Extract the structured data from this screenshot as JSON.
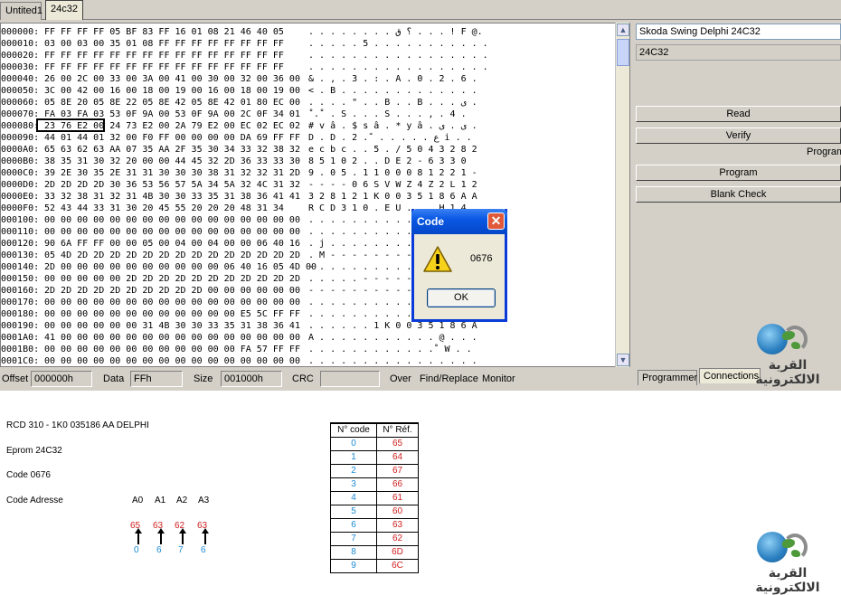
{
  "tabs": [
    {
      "label": "Untited1"
    },
    {
      "label": "24c32"
    }
  ],
  "hex_rows": [
    {
      "offset": "000000:",
      "hex": "FF FF FF FF 05 BF 83 FF 16 01 08 21 46 40 05",
      "ascii": ". . . . . . . . ؟ ق . . . ! F @."
    },
    {
      "offset": "000010:",
      "hex": "03 00 03 00 35 01 08 FF FF FF FF FF FF FF FF",
      "ascii": ". . . . . 5 . . . . . . . . . . ."
    },
    {
      "offset": "000020:",
      "hex": "FF FF FF FF FF FF FF FF FF FF FF FF FF FF FF",
      "ascii": ". . . . . . . . . . . . . . . . ."
    },
    {
      "offset": "000030:",
      "hex": "FF FF FF FF FF FF FF FF FF FF FF FF FF FF FF",
      "ascii": ". . . . . . . . . . . . . . . . ."
    },
    {
      "offset": "000040:",
      "hex": "26 00 2C 00 33 00 3A 00 41 00 30 00 32 00 36 00",
      "ascii": "& . , . 3 . : . A . 0 . 2 . 6 ."
    },
    {
      "offset": "000050:",
      "hex": "3C 00 42 00 16 00 18 00 19 00 16 00 18 00 19 00",
      "ascii": "< . B . . . . . . . . . . . . ."
    },
    {
      "offset": "000060:",
      "hex": "05 8E 20 05 8E 22 05 8E 42 05 8E 42 01 80 EC 00",
      "ascii": ". . . . \" . . B . . B . . . ى ."
    },
    {
      "offset": "000070:",
      "hex": "FA 03 FA 03 53 0F 9A 00 53 0F 9A 00 2C 0F 34 01",
      "ascii": "ْ . ْ . S . . . S . . . , . 4 ."
    },
    {
      "offset": "000080:",
      "hex": "23 76 E2 00 24 73 E2 00 2A 79 E2 00 EC 02 EC 02",
      "ascii": "# v â . $ s â . * y â . ى . ى ."
    },
    {
      "offset": "000090:",
      "hex": "44 01 44 01 32 00 F0 FF 00 00 00 00 DA 69 FF FF",
      "ascii": "D . D . 2 . ً . . . . . ع i . ."
    },
    {
      "offset": "0000A0:",
      "hex": "65 63 62 63 AA 07 35 AA 2F 35 30 34 33 32 38 32",
      "ascii": "e c b c . . 5 . / 5 0 4 3 2 8 2"
    },
    {
      "offset": "0000B0:",
      "hex": "38 35 31 30 32 20 00 00 44 45 32 2D 36 33 33 30",
      "ascii": "8 5 1 0 2 . . D E 2 - 6 3 3 0"
    },
    {
      "offset": "0000C0:",
      "hex": "39 2E 30 35 2E 31 31 30 30 30 38 31 32 32 31 2D",
      "ascii": "9 . 0 5 . 1 1 0 0 0 8 1 2 2 1 -"
    },
    {
      "offset": "0000D0:",
      "hex": "2D 2D 2D 2D 30 36 53 56 57 5A 34 5A 32 4C 31 32",
      "ascii": "- - - - 0 6 S V W Z 4 Z 2 L 1 2"
    },
    {
      "offset": "0000E0:",
      "hex": "33 32 38 31 32 31 4B 30 30 33 35 31 38 36 41 41",
      "ascii": "3 2 8 1 2 1 K 0 0 3 5 1 8 6 A A"
    },
    {
      "offset": "0000F0:",
      "hex": "52 43 44 33 31 30 20 45 55 20 20 20 48 31 34",
      "ascii": "R C D 3 1 0 . E U . . . H 1 4"
    },
    {
      "offset": "000100:",
      "hex": "00 00 00 00 00 00 00 00 00 00 00 00 00 00 00 00",
      "ascii": ". . . . . . . . . . . . . . . ."
    },
    {
      "offset": "000110:",
      "hex": "00 00 00 00 00 00 00 00 00 00 00 00 00 00 00 00",
      "ascii": ". . . . . . . . . . . . . . . ."
    },
    {
      "offset": "000120:",
      "hex": "90 6A FF FF 00 00 05 00 04 00 04 00 00 06 40 16",
      "ascii": ". j . . . . . . . . . . . . @ ."
    },
    {
      "offset": "000130:",
      "hex": "05 4D 2D 2D 2D 2D 2D 2D 2D 2D 2D 2D 2D 2D 2D 2D",
      "ascii": ". M - - - - - - - - - - - - - -"
    },
    {
      "offset": "000140:",
      "hex": "2D 00 00 00 00 00 00 00 00 00 00 06 40 16 05 4D 00",
      "ascii": "- . . . . . . . . . . . @ . . M"
    },
    {
      "offset": "000150:",
      "hex": "00 00 00 00 00 2D 2D 2D 2D 2D 2D 2D 2D 2D 2D 2D",
      "ascii": ". . . . . - - - - - - - - - - -"
    },
    {
      "offset": "000160:",
      "hex": "2D 2D 2D 2D 2D 2D 2D 2D 2D 2D 00 00 00 00 00 00",
      "ascii": "- - - - - - - - - - . . . . . ."
    },
    {
      "offset": "000170:",
      "hex": "00 00 00 00 00 00 00 00 00 00 00 00 00 00 00 00",
      "ascii": ". . . . . . . . . . . . . . . ."
    },
    {
      "offset": "000180:",
      "hex": "00 00 00 00 00 00 00 00 00 00 00 00 E5 5C FF FF",
      "ascii": ". . . . . . . . . . . . . \\ . ."
    },
    {
      "offset": "000190:",
      "hex": "00 00 00 00 00 00 31 4B 30 30 33 35 31 38 36 41",
      "ascii": ". . . . . . 1 K 0 0 3 5 1 8 6 A"
    },
    {
      "offset": "0001A0:",
      "hex": "41 00 00 00 00 00 00 00 00 00 00 00 00 00 00 00",
      "ascii": "A . . . . . . . . . . . @ . . ."
    },
    {
      "offset": "0001B0:",
      "hex": "00 00 00 00 00 00 00 00 00 00 00 00 FA 57 FF FF",
      "ascii": ". . . . . . . . . . . . ْ W . ."
    },
    {
      "offset": "0001C0:",
      "hex": "00 00 00 00 00 00 00 00 00 00 00 00 00 00 00 00",
      "ascii": ". . . . . . . . . . . . . . . ."
    }
  ],
  "status": {
    "offset_label": "Offset",
    "offset_value": "000000h",
    "data_label": "Data",
    "data_value": "FFh",
    "size_label": "Size",
    "size_value": "001000h",
    "crc_label": "CRC",
    "crc_value": "",
    "over_label": "Over",
    "find_label": "Find/Replace",
    "monitor_label": "Monitor"
  },
  "right_panel": {
    "device_name": "Skoda Swing Delphi 24C32",
    "chip": "24C32",
    "read_label": "Read",
    "verify_label": "Verify",
    "program_partial_label": "Program",
    "program_label": "Program",
    "blank_check_label": "Blank Check",
    "tab_programmer": "Programmer",
    "tab_connections": "Connections"
  },
  "dialog": {
    "title": "Code",
    "message": "0676",
    "ok_label": "OK",
    "icon": "warning-icon"
  },
  "logo": {
    "text": "القرية الالكترونية"
  },
  "doc": {
    "line1": "RCD 310 - 1K0 035186 AA DELPHI",
    "line2": "Eprom 24C32",
    "line3": "Code 0676",
    "line4": "Code Adresse",
    "addresses": [
      "A0",
      "A1",
      "A2",
      "A3"
    ],
    "values": [
      "65",
      "63",
      "62",
      "63"
    ],
    "codes": [
      "0",
      "6",
      "7",
      "6"
    ]
  },
  "code_table": {
    "header_code": "N° code",
    "header_ref": "N° Réf.",
    "rows": [
      {
        "code": "0",
        "ref": "65"
      },
      {
        "code": "1",
        "ref": "64"
      },
      {
        "code": "2",
        "ref": "67"
      },
      {
        "code": "3",
        "ref": "66"
      },
      {
        "code": "4",
        "ref": "61"
      },
      {
        "code": "5",
        "ref": "60"
      },
      {
        "code": "6",
        "ref": "63"
      },
      {
        "code": "7",
        "ref": "62"
      },
      {
        "code": "8",
        "ref": "6D"
      },
      {
        "code": "9",
        "ref": "6C"
      }
    ]
  },
  "colors": {
    "title_bar": "#0a58e4",
    "ref_red": "#d02020",
    "code_blue": "#1a8ad4"
  }
}
